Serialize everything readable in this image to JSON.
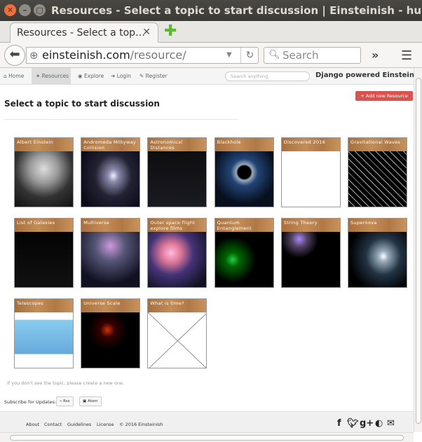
{
  "window": {
    "title": "Resources - Select a topic to start discussion | Einsteinish - hub to see Un"
  },
  "tab": {
    "label": "Resources - Select a top…"
  },
  "address": {
    "host": "einsteinish.com",
    "path": "/resource/"
  },
  "browser_search": {
    "placeholder": "Search"
  },
  "site_nav": {
    "home": "Home",
    "resources": "Resources",
    "explore": "Explore",
    "login": "Login",
    "register": "Register",
    "search_placeholder": "Search anything",
    "brand": "Django powered Einsteinish"
  },
  "add_button": "Add new Resource",
  "heading": "Select a topic to start discussion",
  "topics": [
    {
      "label": "Albert Einstein",
      "icon": "einstein-portrait"
    },
    {
      "label": "Andromeda Milkyway Collision",
      "icon": "galaxy-collision"
    },
    {
      "label": "Astronomical Distances",
      "icon": "distance-diagram"
    },
    {
      "label": "Blackhole",
      "icon": "blackhole"
    },
    {
      "label": "Discovered 2016",
      "icon": "year-2016"
    },
    {
      "label": "Gravitational Waves",
      "icon": "spacetime-grid"
    },
    {
      "label": "List of Galaxies",
      "icon": "galaxy-list"
    },
    {
      "label": "Multiverse",
      "icon": "bubble-universes"
    },
    {
      "label": "Outer space flight explore films",
      "icon": "spaceship-film"
    },
    {
      "label": "Quantum Entanglement",
      "icon": "quantum-particles"
    },
    {
      "label": "String Theory",
      "icon": "string-shapes"
    },
    {
      "label": "Supernova",
      "icon": "supernova"
    },
    {
      "label": "Telescopes",
      "icon": "telescope-spectrum"
    },
    {
      "label": "Universe Scale",
      "icon": "universe-scale"
    },
    {
      "label": "What is time?",
      "icon": "light-cone"
    }
  ],
  "hint": "If you don't see the topic, please create a new one.",
  "subscribe": {
    "label": "Subscribe for Updates:",
    "rss": "Rss",
    "atom": "Atom"
  },
  "footer": {
    "about": "About",
    "contact": "Contact",
    "guidelines": "Guidelines",
    "license": "License",
    "copyright": "© 2016 Einsteinish"
  },
  "colors": {
    "titlebar": "#3b3a36",
    "close": "#f06f3a",
    "label_wood": "#b07845",
    "add_button": "#d9534f"
  }
}
